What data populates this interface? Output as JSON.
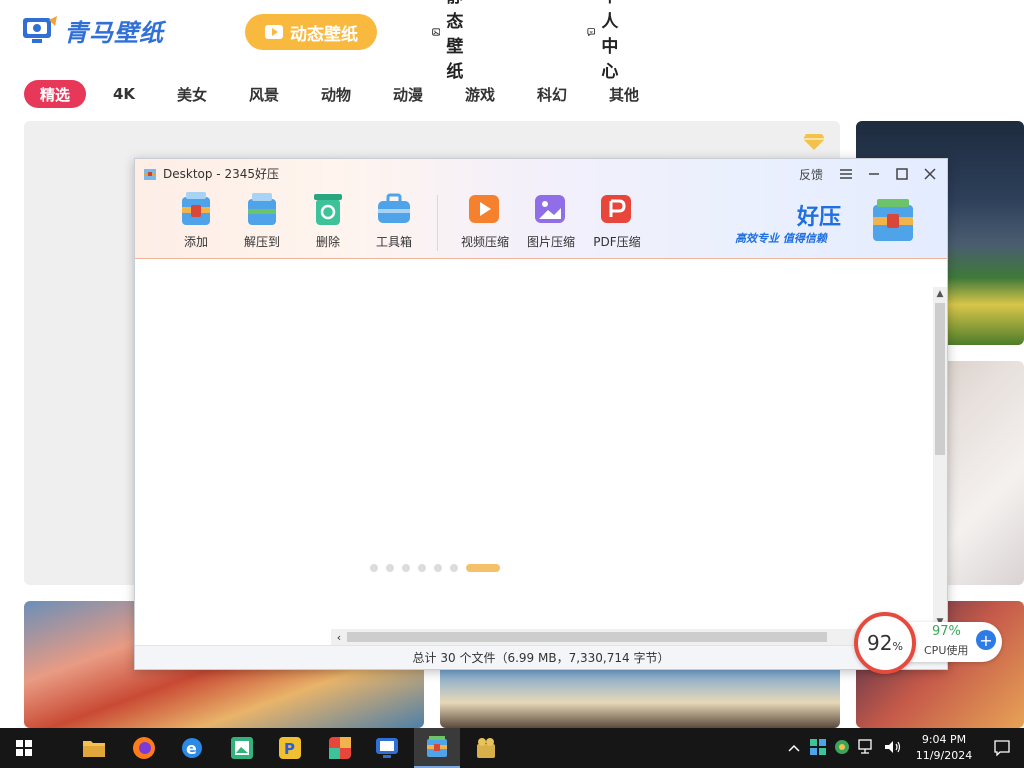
{
  "app": {
    "logo_text": "青马壁纸",
    "nav": [
      {
        "label": "动态壁纸",
        "active": true
      },
      {
        "label": "静态壁纸"
      },
      {
        "label": "个人中心"
      }
    ],
    "categories": [
      "精选",
      "4K",
      "美女",
      "风景",
      "动物",
      "动漫",
      "游戏",
      "科幻",
      "其他"
    ],
    "active_category": "精选",
    "accent_color": "#f9b93e",
    "category_active_color": "#e8385a"
  },
  "archiver": {
    "title": "Desktop - 2345好压",
    "feedback": "反馈",
    "tools": [
      {
        "label": "添加",
        "icon": "archive-add-icon"
      },
      {
        "label": "解压到",
        "icon": "extract-icon"
      },
      {
        "label": "删除",
        "icon": "recycle-icon"
      },
      {
        "label": "工具箱",
        "icon": "toolbox-icon"
      },
      {
        "label": "视频压缩",
        "icon": "video-compress-icon"
      },
      {
        "label": "图片压缩",
        "icon": "image-compress-icon"
      },
      {
        "label": "PDF压缩",
        "icon": "pdf-compress-icon"
      }
    ],
    "brand_name": "好压",
    "brand_slogan": "高效专业  值得信赖",
    "status": "总计 30 个文件（6.99 MB，7,330,714 字节）"
  },
  "cpu_widget": {
    "percent": "92",
    "percent_sign": "%",
    "cpu_value": "97%",
    "cpu_label": "CPU使用"
  },
  "taskbar": {
    "time": "9:04 PM",
    "date": "11/9/2024"
  }
}
